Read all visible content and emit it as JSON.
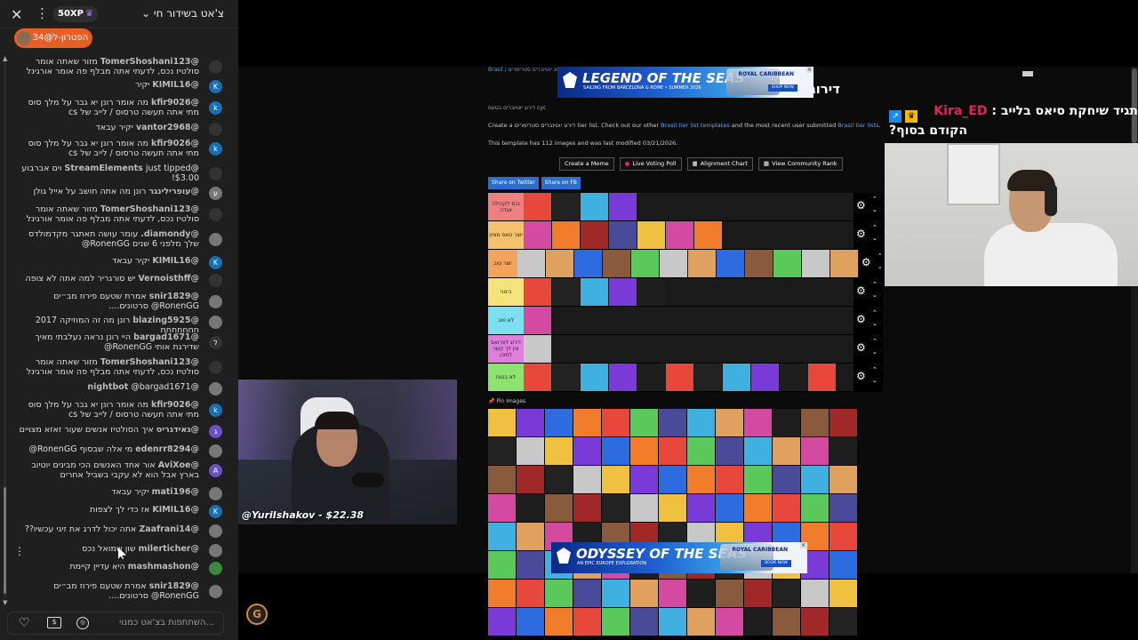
{
  "chat": {
    "title": "צ'אט בשידור חי",
    "xp_badge": "50XP",
    "pinned_label": "הפטרון-ל@34",
    "input_placeholder": "השתתפות בצ'אט כמנוי...",
    "icons": {
      "close": "close-icon",
      "menu": "kebab-menu-icon",
      "heart": "heart-icon",
      "donate": "dollar-icon",
      "coin": "coin-icon"
    },
    "messages": [
      {
        "user": "@TomerShoshani123",
        "text": "מזור שאתה אומר סולטיז נכס, לדעתי אתה מבלף פה אומר אורגינל",
        "avatar": "",
        "avatar_style": "dark"
      },
      {
        "user": "@KIMIL16",
        "text": "יקיר",
        "avatar": "K",
        "avatar_style": "k"
      },
      {
        "user": "@kfir9026",
        "text": "מה אומר רונן יא גבר על מלך סוס מתי אתה תעשה טרסוס / לייב של cs",
        "avatar": "k",
        "avatar_style": "k"
      },
      {
        "user": "@vantor2968",
        "text": "יקיר עבאד",
        "avatar": "",
        "avatar_style": "dark"
      },
      {
        "user": "@kfir9026",
        "text": "מה אומר רונן יא גבר על מלך סוס מתי אתה תעשה טרסוס / לייב של cs",
        "avatar": "k",
        "avatar_style": "k"
      },
      {
        "user": "@StreamElements",
        "text": "just tipped וים אברבוע $3.00!",
        "avatar": "",
        "avatar_style": "dark"
      },
      {
        "user": "@עופרילינגר",
        "text": "רונן מה אתה חושב על אייל גולן",
        "avatar": "ע",
        "avatar_style": "g"
      },
      {
        "user": "@TomerShoshani123",
        "text": "מזור שאתה אומר סולטיז נכס, לדעתי אתה מבלף פה אומר אורגינל",
        "avatar": "",
        "avatar_style": "dark"
      },
      {
        "user": "@diamondy.",
        "text": "עומר עושה תאתגר מקדמולדס שלך מלפני 6 שנים RonenGG@",
        "avatar": "",
        "avatar_style": "g"
      },
      {
        "user": "@KIMIL16",
        "text": "יקיר עבאד",
        "avatar": "K",
        "avatar_style": "k"
      },
      {
        "user": "@Vernoisthff",
        "text": "יש סורגריר למה אתה לא צופה",
        "avatar": "",
        "avatar_style": "dark"
      },
      {
        "user": "@snir1829",
        "text": "אמרת שטעם פירוז מב״ים RonenGG@ סרטונים....",
        "avatar": "",
        "avatar_style": "g"
      },
      {
        "user": "@blazing5925",
        "text": "רונן מה זה המוזיקה 2017 חחחחחחח",
        "avatar": "",
        "avatar_style": "g"
      },
      {
        "user": "@bargad1671",
        "text": "היי רונן נראה נעלבתי מאיך שדירגת אותי RonenGG@",
        "avatar": "ל",
        "avatar_style": "dark"
      },
      {
        "user": "@TomerShoshani123",
        "text": "מזור שאתה אומר סולטיז נכס, לדעתי אתה מבלף פה אומר אורגינל",
        "avatar": "",
        "avatar_style": "dark"
      },
      {
        "user": "@nightbot",
        "text": "@bargad1671",
        "avatar": "",
        "avatar_style": "g"
      },
      {
        "user": "@kfir9026",
        "text": "מה אומר רונן יא גבר על מלך סוס מתי אתה תעשה טרסוס / לייב של cs",
        "avatar": "k",
        "avatar_style": "k"
      },
      {
        "user": "@גאידגריס",
        "text": "איך הסולטיז אנשים שעור זאזא מצויים",
        "avatar": "ג",
        "avatar_style": "purple"
      },
      {
        "user": "@edenrr8294",
        "text": "מי אלה שבסוף RonenGG@",
        "avatar": "",
        "avatar_style": "g"
      },
      {
        "user": "@AviXoe",
        "text": "אור אחד האנשים הכי מבינים יוטיוב בארץ אבל הוא לא עקבי בשביל אחרים",
        "avatar": "A",
        "avatar_style": "purple"
      },
      {
        "user": "@mati196",
        "text": "יקיר עבאד",
        "avatar": "",
        "avatar_style": "g"
      },
      {
        "user": "@KIMIL16",
        "text": "אז כדי לך לצפות",
        "avatar": "K",
        "avatar_style": "k"
      },
      {
        "user": "@Zaafrani14",
        "text": "אתה יכול לדרג את זיגי עכשיו??",
        "avatar": "",
        "avatar_style": "g"
      },
      {
        "user": "@milerticher",
        "text": "שון שמואל נכס",
        "avatar": "",
        "avatar_style": "g"
      },
      {
        "user": "@mashmashon",
        "text": "היא עדיין קיימת",
        "avatar": "",
        "avatar_style": "green"
      },
      {
        "user": "@snir1829",
        "text": "אמרת שטעם פירוז מב״ים RonenGG@ סרטונים....",
        "avatar": "",
        "avatar_style": "g"
      }
    ]
  },
  "cam_left": {
    "donation": "@YuriIshakov - $22.38"
  },
  "alert": {
    "name": "Kira_ED",
    "text1": "תגיד שיחקת סיאס בלייב :",
    "text2": "?הקודם בסוף"
  },
  "tierlist": {
    "breadcrumb": "Brasil / דירוג יוטיוברים סטרימרים",
    "title": "דירוג יוטיוברים סטרימרים",
    "subline": "דירוג יוטיוברים בטעם cyc",
    "desc_pre": "Create a דירוג יוטיוברים סטרימרים tier list. Check out our other",
    "desc_link1": "Brasil tier list templates",
    "desc_mid": "and the most recent user submitted",
    "desc_link2": "Brasil tier lists",
    "desc2": "This template has 112 images and was last modified 03/21/2026.",
    "buttons": [
      "Create a Meme",
      "Live Voting Poll",
      "Alignment Chart",
      "View Community Rank"
    ],
    "shares": [
      "Share on Twitter",
      "Share on FB"
    ],
    "pin_header": "Pin Images",
    "tiers": [
      {
        "label": "נכס לקהילה אגדה",
        "color": "#f08080",
        "count": 4
      },
      {
        "label": "יוצר טאפ מצוין",
        "color": "#f5c16c",
        "count": 7
      },
      {
        "label": "יוצר טוב",
        "color": "#f3a45c",
        "count": 12
      },
      {
        "label": "בינוני",
        "color": "#f4e27a",
        "count": 5
      },
      {
        "label": "לא טוב",
        "color": "#7de0f0",
        "count": 1
      },
      {
        "label": "דירוג לפרואס אין לך קשר לתוכן",
        "color": "#e07ee0",
        "count": 1
      },
      {
        "label": "לא בטוח",
        "color": "#8ee36e",
        "count": 11
      }
    ],
    "pool_count": 104
  },
  "ads": [
    {
      "headline": "LEGEND OF THE SEAS",
      "sub": "SAILING FROM BARCELONA & ROME • SUMMER 2026",
      "brand": "ROYAL CARIBBEAN",
      "cta": "SHOP NOW"
    },
    {
      "headline": "ODYSSEY OF THE SEAS",
      "sub": "AN EPIC EUROPE EXPLORATION",
      "brand": "ROYAL CARIBBEAN",
      "cta": "BOOK NOW"
    }
  ],
  "colors": {
    "chat_bg": "#1f1f1f",
    "pinned": "#e85d24",
    "accent_blue": "#2a6fd0"
  }
}
